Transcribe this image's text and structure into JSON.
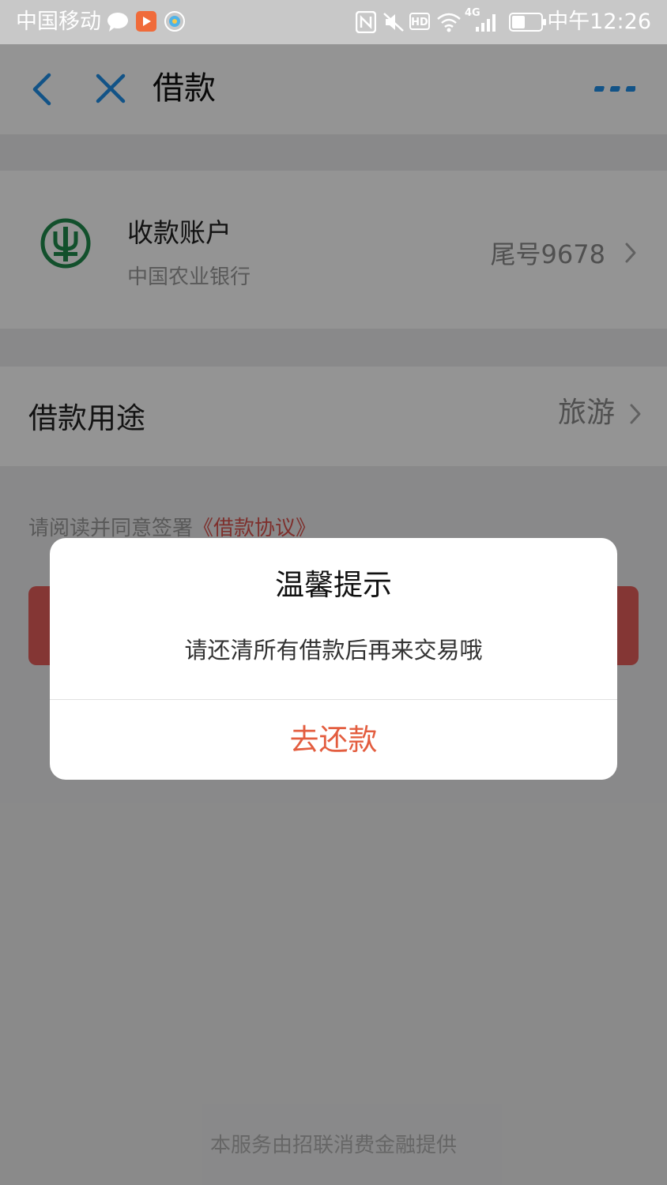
{
  "status_bar": {
    "carrier": "中国移动",
    "network": "4G",
    "hd": "HD",
    "time": "中午12:26"
  },
  "nav": {
    "title": "借款"
  },
  "account": {
    "title": "收款账户",
    "bank": "中国农业银行",
    "tail": "尾号9678"
  },
  "purpose": {
    "label": "借款用途",
    "value": "旅游"
  },
  "agreement": {
    "prefix": "请阅读并同意签署",
    "link": "《借款协议》"
  },
  "footer": "本服务由招联消费金融提供",
  "dialog": {
    "title": "温馨提示",
    "message": "请还清所有借款后再来交易哦",
    "button": "去还款"
  },
  "colors": {
    "accent_blue": "#1f8fe8",
    "primary_red": "#e35d5b",
    "bank_green": "#1f8a4c"
  }
}
